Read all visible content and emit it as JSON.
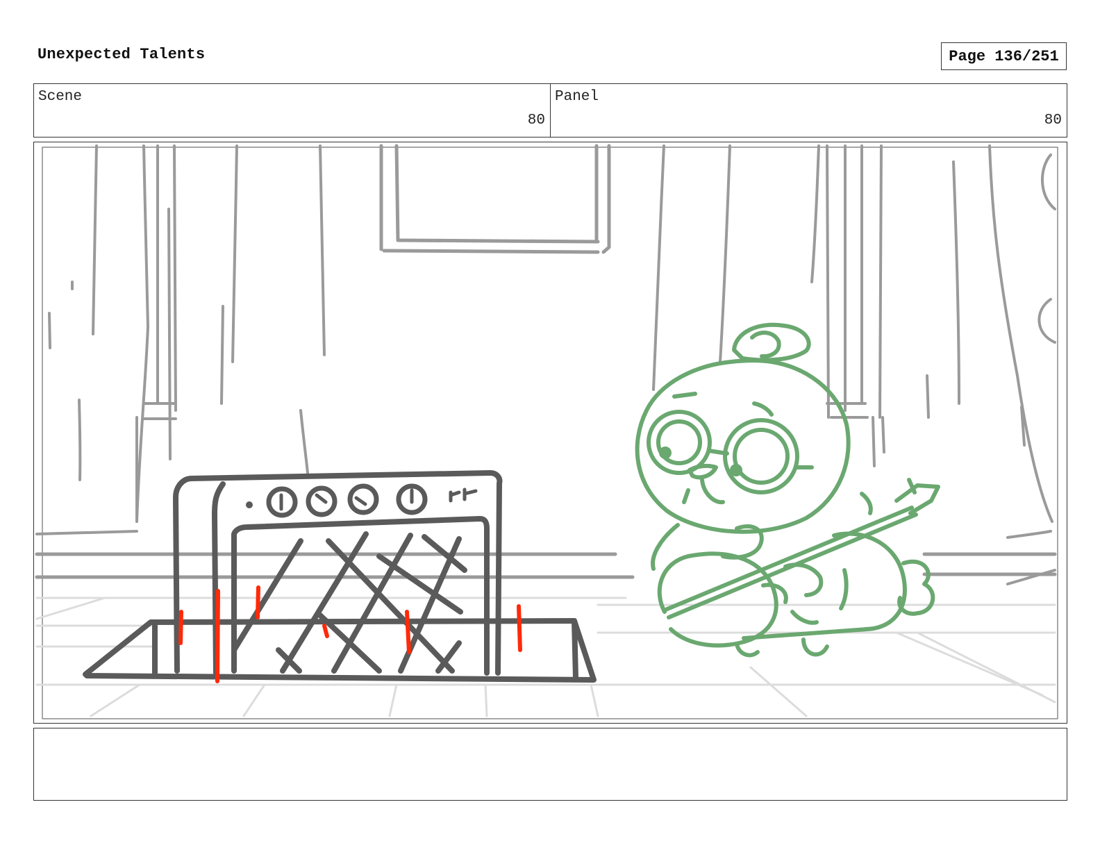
{
  "document": {
    "title": "Unexpected Talents",
    "page_label": "Page 136/251"
  },
  "info": {
    "scene_label": "Scene",
    "scene_value": "80",
    "panel_label": "Panel",
    "panel_value": "80"
  },
  "drawing": {
    "colors": {
      "background_sketch": "#9a9a9a",
      "floor_lines": "#dcdcdc",
      "amp": "#5a5a5a",
      "accent": "#ff2a0a",
      "character": "#6aa870"
    },
    "icons": [
      "amplifier-sketch",
      "character-with-guitar-sketch",
      "window-sketch",
      "curtain-sketch"
    ]
  },
  "notes": {
    "text": ""
  }
}
